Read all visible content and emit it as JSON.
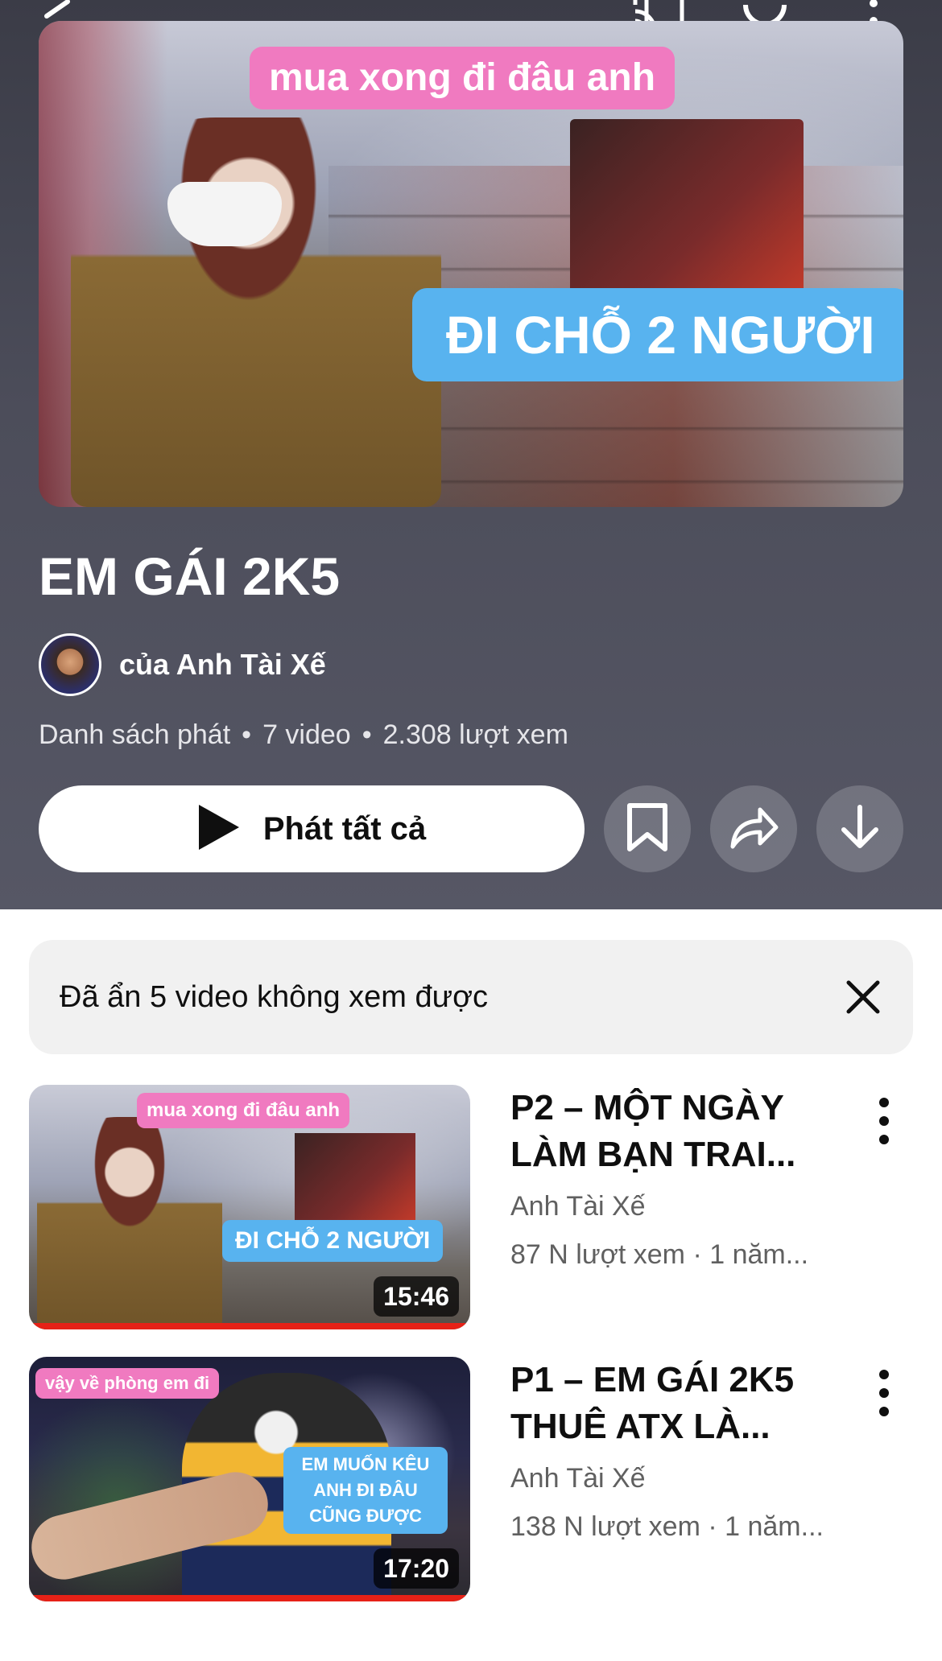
{
  "header": {
    "hero_caption_top": "mua xong đi đâu anh",
    "hero_caption_main": "ĐI CHỖ 2 NGƯỜI",
    "title": "EM GÁI 2K5",
    "owner": "của Anh Tài Xế",
    "meta": {
      "type": "Danh sách phát",
      "count": "7 video",
      "views": "2.308 lượt xem"
    },
    "play_all_label": "Phát tất cả"
  },
  "notice": {
    "text": "Đã ẩn 5 video không xem được"
  },
  "videos": [
    {
      "title": "P2 – MỘT NGÀY LÀM BẠN TRAI...",
      "channel": "Anh Tài Xế",
      "stats": "87 N lượt xem · 1 năm...",
      "duration": "15:46",
      "caption_top": "mua xong đi đâu anh",
      "caption_main": "ĐI CHỖ 2 NGƯỜI",
      "watched_fraction": 1.0
    },
    {
      "title": "P1 – EM GÁI 2K5 THUÊ ATX LÀ...",
      "channel": "Anh Tài Xế",
      "stats": "138 N lượt xem · 1 năm...",
      "duration": "17:20",
      "caption_top": "vậy về phòng em đi",
      "caption_main": "EM MUỐN KÊU ANH ĐI ĐÂU CŨNG ĐƯỢC",
      "watched_fraction": 1.0
    }
  ],
  "icons": {
    "back": "back-arrow-icon",
    "cast": "cast-icon",
    "search": "search-icon",
    "more": "more-vertical-icon",
    "play": "play-icon",
    "save": "bookmark-icon",
    "share": "share-icon",
    "download": "download-icon",
    "close": "close-icon"
  },
  "colors": {
    "header_bg": "#4c4d5a",
    "caption_pink": "#f07ac0",
    "caption_blue": "#58b3ef",
    "progress_red": "#e62117"
  }
}
